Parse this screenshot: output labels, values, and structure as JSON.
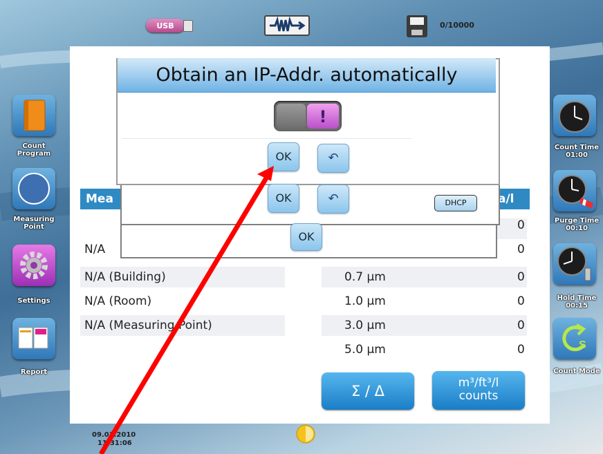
{
  "statusbar": {
    "usb_label": "USB",
    "memory_counter": "0/10000",
    "date": "09.01.2010",
    "time": "11:31:06"
  },
  "left_sidebar": [
    {
      "label": "Count Program",
      "icon": "book-icon"
    },
    {
      "label": "Measuring Point",
      "icon": "compass-icon"
    },
    {
      "label": "Settings",
      "icon": "gear-icon"
    },
    {
      "label": "Report",
      "icon": "report-icon"
    }
  ],
  "right_sidebar": [
    {
      "label": "Count Time",
      "value": "01:00",
      "icon": "clock-icon"
    },
    {
      "label": "Purge Time",
      "value": "00:10",
      "icon": "purge-clock-icon"
    },
    {
      "label": "Hold Time",
      "value": "00:15",
      "icon": "hold-clock-icon"
    },
    {
      "label": "Count Mode",
      "icon": "count-mode-icon"
    }
  ],
  "table": {
    "header_left": "Mea",
    "header_right": "a/l",
    "left_rows": [
      "",
      "N/A",
      "N/A (Building)",
      "N/A (Room)",
      "N/A (Measuring Point)",
      ""
    ],
    "sizes": [
      "",
      "",
      "0.7 µm",
      "1.0 µm",
      "3.0 µm",
      "5.0 µm"
    ],
    "counts": [
      "0",
      "0",
      "0",
      "0",
      "0",
      "0"
    ]
  },
  "bottom_buttons": {
    "sum_delta": "Σ / Δ",
    "units_line1": "m³/ft³/l",
    "units_line2": "counts"
  },
  "dialog": {
    "title": "Obtain an IP-Addr. automatically",
    "toggle_symbol": "!",
    "ok_label": "OK",
    "dhcp_label": "DHCP",
    "back_symbol": "↶"
  },
  "colors": {
    "accent": "#2f8ac4",
    "toggle_on": "#d070e0",
    "annotation_arrow": "#ff0000"
  }
}
